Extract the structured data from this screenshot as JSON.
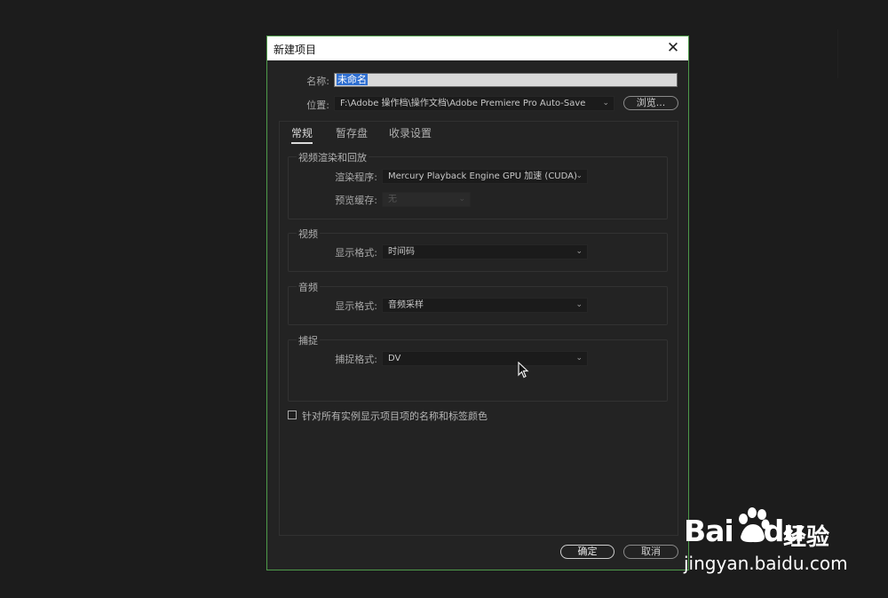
{
  "dialog": {
    "title": "新建项目",
    "close_glyph": "✕",
    "name_label": "名称:",
    "name_value": "未命名",
    "location_label": "位置:",
    "location_value": "F:\\Adobe 操作档\\操作文档\\Adobe Premiere Pro Auto-Save",
    "browse_label": "浏览...",
    "tabs": [
      "常规",
      "暂存盘",
      "收录设置"
    ],
    "groups": {
      "render": {
        "title": "视频渲染和回放",
        "renderer_label": "渲染程序:",
        "renderer_value": "Mercury Playback Engine GPU 加速 (CUDA)",
        "preview_cache_label": "预览缓存:",
        "preview_cache_value": "无"
      },
      "video": {
        "title": "视频",
        "display_format_label": "显示格式:",
        "display_format_value": "时间码"
      },
      "audio": {
        "title": "音频",
        "display_format_label": "显示格式:",
        "display_format_value": "音频采样"
      },
      "capture": {
        "title": "捕捉",
        "capture_format_label": "捕捉格式:",
        "capture_format_value": "DV"
      }
    },
    "checkbox_label": "针对所有实例显示项目项的名称和标签颜色",
    "checkbox_checked": false,
    "ok_label": "确定",
    "cancel_label": "取消"
  },
  "watermark": {
    "brand_left": "Bai",
    "brand_right": "du",
    "jingyan": "经验",
    "url": "jingyan.baidu.com"
  },
  "icons": {
    "chevron": "chevron-down-icon",
    "cursor": "mouse-pointer-icon",
    "paw": "baidu-paw-icon"
  },
  "colors": {
    "accent_border": "#4e9a4a",
    "selection": "#2f6fd1"
  }
}
